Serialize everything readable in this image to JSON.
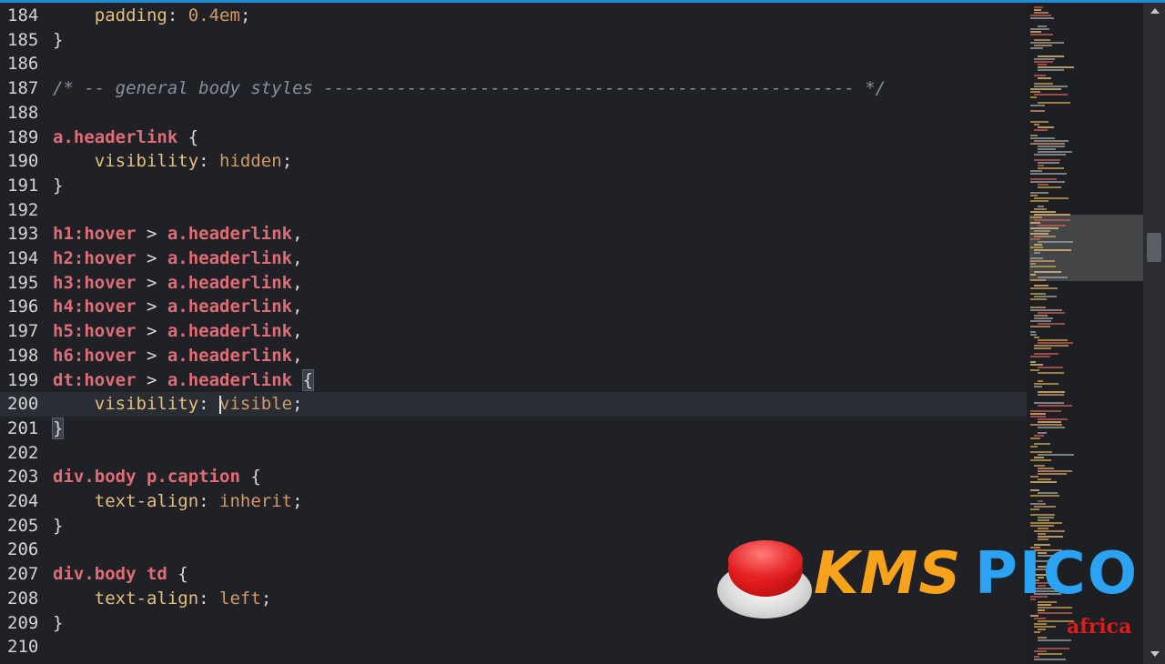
{
  "editor": {
    "current_line": 200,
    "lines": [
      {
        "n": "184",
        "tokens": [
          {
            "t": "    ",
            "c": "punc"
          },
          {
            "t": "padding",
            "c": "prop"
          },
          {
            "t": ": ",
            "c": "punc"
          },
          {
            "t": "0.4em",
            "c": "val"
          },
          {
            "t": ";",
            "c": "punc"
          }
        ]
      },
      {
        "n": "185",
        "tokens": [
          {
            "t": "}",
            "c": "punc"
          }
        ]
      },
      {
        "n": "186",
        "tokens": []
      },
      {
        "n": "187",
        "tokens": [
          {
            "t": "/* -- general body styles --------------------------------------------------- */",
            "c": "comment"
          }
        ]
      },
      {
        "n": "188",
        "tokens": []
      },
      {
        "n": "189",
        "tokens": [
          {
            "t": "a.headerlink",
            "c": "sel"
          },
          {
            "t": " {",
            "c": "punc"
          }
        ]
      },
      {
        "n": "190",
        "tokens": [
          {
            "t": "    ",
            "c": "punc"
          },
          {
            "t": "visibility",
            "c": "prop"
          },
          {
            "t": ": ",
            "c": "punc"
          },
          {
            "t": "hidden",
            "c": "val"
          },
          {
            "t": ";",
            "c": "punc"
          }
        ]
      },
      {
        "n": "191",
        "tokens": [
          {
            "t": "}",
            "c": "punc"
          }
        ]
      },
      {
        "n": "192",
        "tokens": []
      },
      {
        "n": "193",
        "tokens": [
          {
            "t": "h1:hover",
            "c": "sel"
          },
          {
            "t": " > ",
            "c": "punc"
          },
          {
            "t": "a.headerlink",
            "c": "sel"
          },
          {
            "t": ",",
            "c": "punc"
          }
        ]
      },
      {
        "n": "194",
        "tokens": [
          {
            "t": "h2:hover",
            "c": "sel"
          },
          {
            "t": " > ",
            "c": "punc"
          },
          {
            "t": "a.headerlink",
            "c": "sel"
          },
          {
            "t": ",",
            "c": "punc"
          }
        ]
      },
      {
        "n": "195",
        "tokens": [
          {
            "t": "h3:hover",
            "c": "sel"
          },
          {
            "t": " > ",
            "c": "punc"
          },
          {
            "t": "a.headerlink",
            "c": "sel"
          },
          {
            "t": ",",
            "c": "punc"
          }
        ]
      },
      {
        "n": "196",
        "tokens": [
          {
            "t": "h4:hover",
            "c": "sel"
          },
          {
            "t": " > ",
            "c": "punc"
          },
          {
            "t": "a.headerlink",
            "c": "sel"
          },
          {
            "t": ",",
            "c": "punc"
          }
        ]
      },
      {
        "n": "197",
        "tokens": [
          {
            "t": "h5:hover",
            "c": "sel"
          },
          {
            "t": " > ",
            "c": "punc"
          },
          {
            "t": "a.headerlink",
            "c": "sel"
          },
          {
            "t": ",",
            "c": "punc"
          }
        ]
      },
      {
        "n": "198",
        "tokens": [
          {
            "t": "h6:hover",
            "c": "sel"
          },
          {
            "t": " > ",
            "c": "punc"
          },
          {
            "t": "a.headerlink",
            "c": "sel"
          },
          {
            "t": ",",
            "c": "punc"
          }
        ]
      },
      {
        "n": "199",
        "tokens": [
          {
            "t": "dt:hover",
            "c": "sel"
          },
          {
            "t": " > ",
            "c": "punc"
          },
          {
            "t": "a.headerlink",
            "c": "sel"
          },
          {
            "t": " ",
            "c": "punc"
          },
          {
            "t": "{",
            "c": "punc brace-hl"
          }
        ]
      },
      {
        "n": "200",
        "tokens": [
          {
            "t": "    ",
            "c": "punc"
          },
          {
            "t": "visibility",
            "c": "prop"
          },
          {
            "t": ": ",
            "c": "punc"
          },
          {
            "t": "",
            "c": "caret"
          },
          {
            "t": "visible",
            "c": "val"
          },
          {
            "t": ";",
            "c": "punc"
          }
        ]
      },
      {
        "n": "201",
        "tokens": [
          {
            "t": "}",
            "c": "punc brace-hl"
          }
        ]
      },
      {
        "n": "202",
        "tokens": []
      },
      {
        "n": "203",
        "tokens": [
          {
            "t": "div.body p.caption",
            "c": "sel"
          },
          {
            "t": " {",
            "c": "punc"
          }
        ]
      },
      {
        "n": "204",
        "tokens": [
          {
            "t": "    ",
            "c": "punc"
          },
          {
            "t": "text-align",
            "c": "prop"
          },
          {
            "t": ": ",
            "c": "punc"
          },
          {
            "t": "inherit",
            "c": "val"
          },
          {
            "t": ";",
            "c": "punc"
          }
        ]
      },
      {
        "n": "205",
        "tokens": [
          {
            "t": "}",
            "c": "punc"
          }
        ]
      },
      {
        "n": "206",
        "tokens": []
      },
      {
        "n": "207",
        "tokens": [
          {
            "t": "div.body td",
            "c": "sel"
          },
          {
            "t": " {",
            "c": "punc"
          }
        ]
      },
      {
        "n": "208",
        "tokens": [
          {
            "t": "    ",
            "c": "punc"
          },
          {
            "t": "text-align",
            "c": "prop"
          },
          {
            "t": ": ",
            "c": "punc"
          },
          {
            "t": "left",
            "c": "val"
          },
          {
            "t": ";",
            "c": "punc"
          }
        ]
      },
      {
        "n": "209",
        "tokens": [
          {
            "t": "}",
            "c": "punc"
          }
        ]
      },
      {
        "n": "210",
        "tokens": []
      }
    ]
  },
  "colors": {
    "background": "#1f2126",
    "selector": "#e06c75",
    "property": "#e5c07b",
    "value": "#d19a66",
    "comment": "#8a8f98",
    "accent": "#1f8dd6"
  },
  "watermark": {
    "icon": "red-push-button-icon",
    "brand_part1": "KMS",
    "brand_part2": "PICO",
    "region": "africa"
  }
}
